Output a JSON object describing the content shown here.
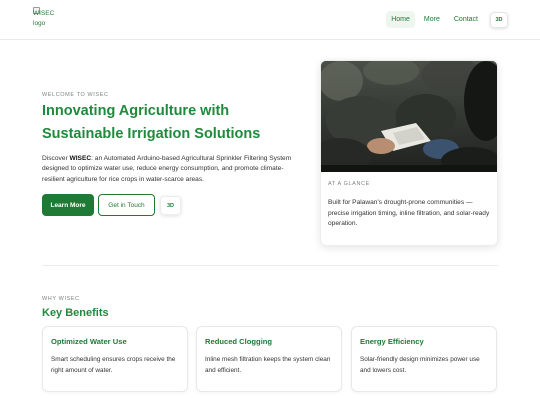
{
  "header": {
    "logo_alt": "WISEC logo",
    "nav": [
      {
        "label": "Home"
      },
      {
        "label": "More"
      },
      {
        "label": "Contact"
      }
    ],
    "toggle_3d_label": "3D"
  },
  "hero": {
    "eyebrow": "WELCOME TO WISEC",
    "title": "Innovating Agriculture with Sustainable Irrigation Solutions",
    "desc_prefix": "Discover ",
    "desc_brand": "WISEC",
    "desc_suffix": ": an Automated Arduino-based Agricultural Sprinkler Filtering System designed to optimize water use, reduce energy consumption, and promote climate-resilient agriculture for rice crops in water-scarce areas.",
    "primary_button": "Learn More",
    "secondary_button": "Get in Touch",
    "toggle_3d_label": "3D"
  },
  "glance": {
    "label": "AT A GLANCE",
    "text": "Built for Palawan's drought-prone communities — precise irrigation timing, inline filtration, and solar-ready operation."
  },
  "why": {
    "eyebrow": "WHY WISEC",
    "title": "Key Benefits",
    "benefits": [
      {
        "title": "Optimized Water Use",
        "text": "Smart scheduling ensures crops receive the right amount of water."
      },
      {
        "title": "Reduced Clogging",
        "text": "Inline mesh filtration keeps the system clean and efficient."
      },
      {
        "title": "Energy Efficiency",
        "text": "Solar-friendly design minimizes power use and lowers cost."
      }
    ]
  },
  "colors": {
    "brand_green": "#1f7a35",
    "title_green": "#1f8a3c"
  }
}
